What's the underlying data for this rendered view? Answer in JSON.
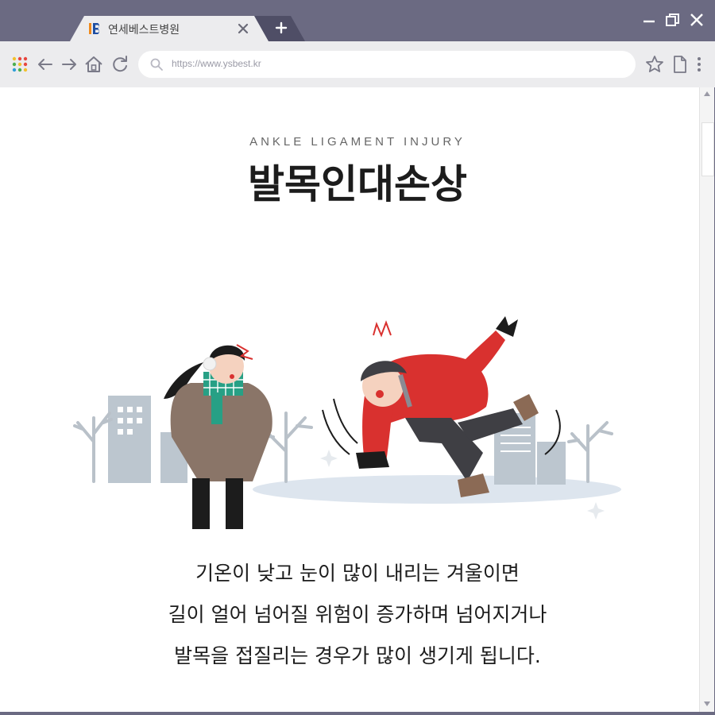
{
  "browser": {
    "tab_title": "연세베스트병원",
    "url": "https://www.ysbest.kr"
  },
  "page": {
    "subtitle": "ANKLE LIGAMENT INJURY",
    "title": "발목인대손상",
    "description_lines": [
      "기온이 낮고 눈이 많이 내리는 겨울이면",
      "길이 얼어 넘어질 위험이 증가하며 넘어지거나",
      "발목을 접질리는 경우가 많이 생기게 됩니다."
    ]
  },
  "colors": {
    "window_frame": "#6b6a82",
    "tab_active": "#ececee",
    "accent_red": "#d9312f",
    "logo_orange": "#f08a1c",
    "logo_blue": "#1f4fa3"
  },
  "icons": [
    "logo-icon",
    "close-tab-icon",
    "new-tab-icon",
    "minimize-icon",
    "restore-icon",
    "close-window-icon",
    "apps-grid-icon",
    "back-arrow-icon",
    "forward-arrow-icon",
    "home-icon",
    "refresh-icon",
    "search-icon",
    "star-icon",
    "page-icon",
    "more-menu-icon"
  ]
}
